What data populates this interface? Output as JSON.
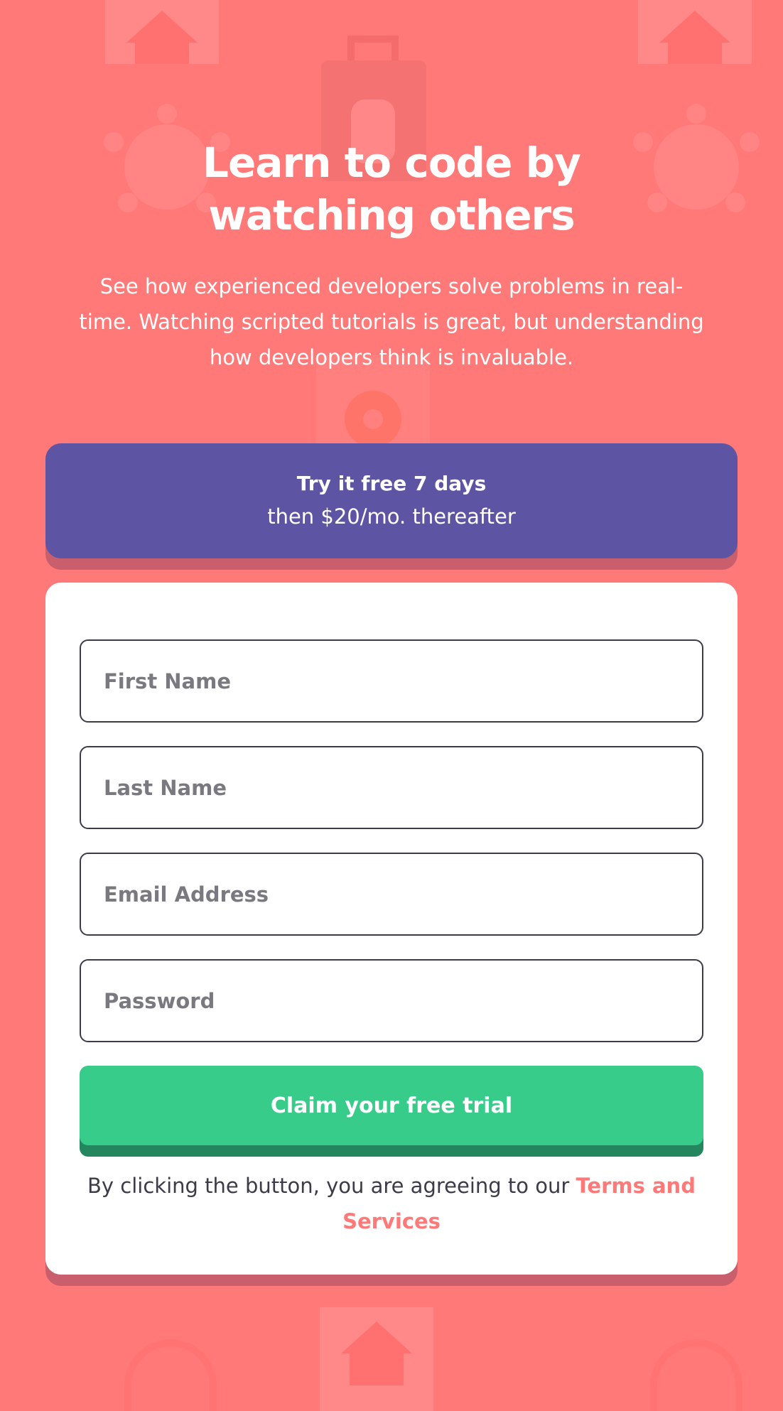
{
  "hero": {
    "title_line1": "Learn to code by",
    "title_line2": "watching others",
    "subtitle_line1": "See how experienced developers solve problems in real-",
    "subtitle_line2": "time. Watching scripted tutorials is great, but understanding",
    "subtitle_line3": "how developers think is invaluable."
  },
  "offer": {
    "strong": "Try it free 7 days",
    "rest": "then $20/mo. thereafter"
  },
  "form": {
    "first_name_placeholder": "First Name",
    "last_name_placeholder": "Last Name",
    "email_placeholder": "Email Address",
    "password_placeholder": "Password",
    "submit_label": "Claim your free trial",
    "terms_text": "By clicking the button, you are agreeing to our",
    "terms_link": "Terms and Services"
  },
  "colors": {
    "background": "#ff7978",
    "banner": "#5e54a4",
    "cta": "#38cc8b",
    "cta_shadow": "#23865f",
    "link": "#ff7978",
    "text_dark": "#3d3b48"
  },
  "icons": [
    "home-icon",
    "toolbox-icon",
    "virus-icon",
    "gear-icon",
    "headphones-icon"
  ]
}
